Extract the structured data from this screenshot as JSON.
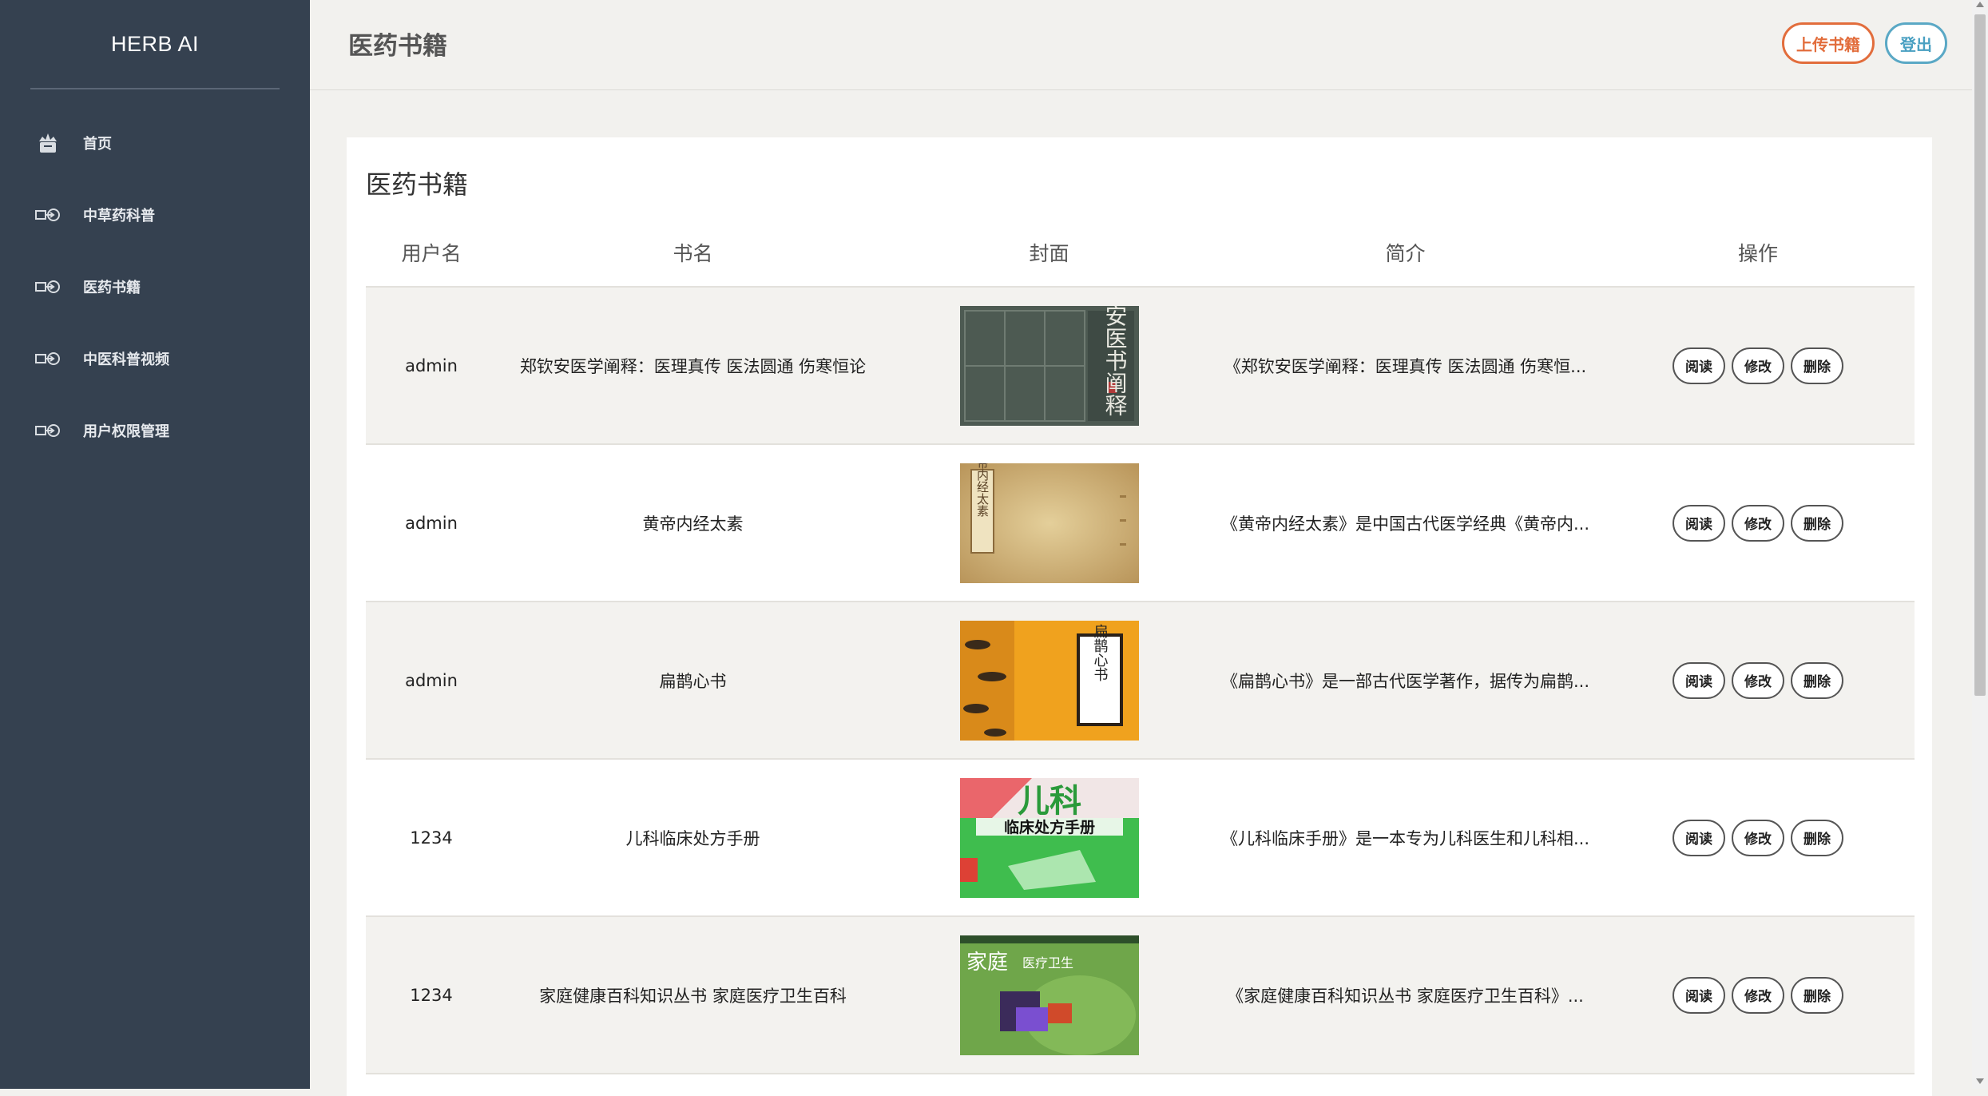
{
  "sidebar": {
    "brand": "HERB AI",
    "items": [
      {
        "label": "首页",
        "icon": "crown-icon"
      },
      {
        "label": "中草药科普",
        "icon": "arrow-circle-icon"
      },
      {
        "label": "医药书籍",
        "icon": "arrow-circle-icon"
      },
      {
        "label": "中医科普视频",
        "icon": "arrow-circle-icon"
      },
      {
        "label": "用户权限管理",
        "icon": "arrow-circle-icon"
      }
    ]
  },
  "header": {
    "title": "医药书籍",
    "upload_label": "上传书籍",
    "logout_label": "登出"
  },
  "card": {
    "title": "医药书籍"
  },
  "table": {
    "columns": [
      "用户名",
      "书名",
      "封面",
      "简介",
      "操作"
    ],
    "rows": [
      {
        "user": "admin",
        "name": "郑钦安医学阐释：医理真传 医法圆通 伤寒恒论",
        "intro": "《郑钦安医学阐释：医理真传 医法圆通 伤寒恒...",
        "cover_text": "郑钦安医书阐释"
      },
      {
        "user": "admin",
        "name": "黄帝内经太素",
        "intro": "《黄帝内经太素》是中国古代医学经典《黄帝内...",
        "cover_text": "黄帝内经太素"
      },
      {
        "user": "admin",
        "name": "扁鹊心书",
        "intro": "《扁鹊心书》是一部古代医学著作，据传为扁鹊...",
        "cover_text": "扁鹊心书"
      },
      {
        "user": "1234",
        "name": "儿科临床处方手册",
        "intro": "《儿科临床手册》是一本专为儿科医生和儿科相...",
        "cover_text": "儿科",
        "cover_sub": "临床处方手册"
      },
      {
        "user": "1234",
        "name": "家庭健康百科知识丛书 家庭医疗卫生百科",
        "intro": "《家庭健康百科知识丛书 家庭医疗卫生百科》...",
        "cover_text": "家庭",
        "cover_sub": "医疗卫生"
      }
    ],
    "actions": {
      "read": "阅读",
      "edit": "修改",
      "delete": "删除"
    }
  },
  "colors": {
    "sidebar_bg": "#354150",
    "upload_accent": "#e26d3c",
    "logout_accent": "#5aa8c5"
  }
}
